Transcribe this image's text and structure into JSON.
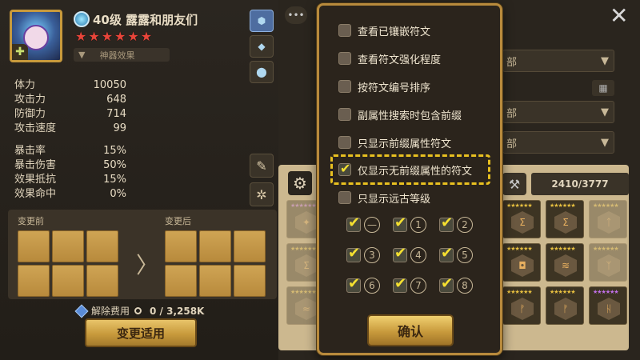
{
  "monster": {
    "name": "40级 露露和朋友们",
    "stars": 6,
    "artifact_label": "神器效果",
    "artifact_arrow": "▼",
    "badge_icon": "✚"
  },
  "stats_primary": [
    {
      "label": "体力",
      "value": "10050"
    },
    {
      "label": "攻击力",
      "value": "648"
    },
    {
      "label": "防御力",
      "value": "714"
    },
    {
      "label": "攻击速度",
      "value": "99"
    }
  ],
  "stats_secondary": [
    {
      "label": "暴击率",
      "value": "15%"
    },
    {
      "label": "暴击伤害",
      "value": "50%"
    },
    {
      "label": "效果抵抗",
      "value": "15%"
    },
    {
      "label": "效果命中",
      "value": "0%"
    }
  ],
  "change": {
    "before_label": "变更前",
    "after_label": "变更后",
    "arrow": "〉",
    "fee_label": "解除费用",
    "fee_value": "0 / 3,258K",
    "apply_label": "变更适用"
  },
  "right": {
    "filter1": "部",
    "filter2": "部",
    "filter3": "部",
    "rune_count": "2410/3777",
    "close": "✕"
  },
  "popup": {
    "options": [
      {
        "label": "查看已镶嵌符文",
        "checked": false
      },
      {
        "label": "查看符文强化程度",
        "checked": false
      },
      {
        "label": "按符文编号排序",
        "checked": false
      },
      {
        "label": "副属性搜索时包含前缀",
        "checked": false
      },
      {
        "label": "只显示前缀属性符文",
        "checked": false
      },
      {
        "label": "仅显示无前缀属性的符文",
        "checked": true
      },
      {
        "label": "只显示远古等级",
        "checked": false
      }
    ],
    "slots": [
      "—",
      "1",
      "2",
      "3",
      "4",
      "5",
      "6",
      "7",
      "8"
    ],
    "confirm_label": "确认"
  }
}
